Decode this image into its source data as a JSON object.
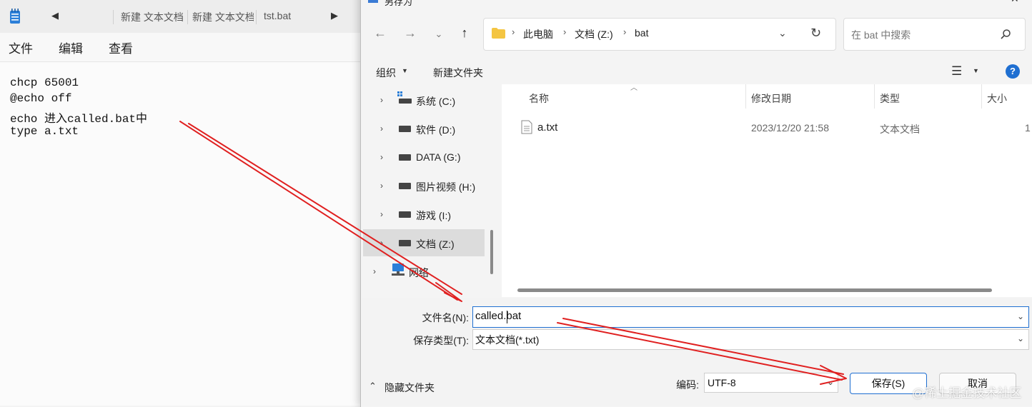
{
  "notepad": {
    "tabs": [
      "新建 文本文档",
      "新建 文本文档",
      "tst.bat"
    ],
    "menu": [
      "文件",
      "编辑",
      "查看"
    ],
    "lines": [
      "chcp 65001",
      "@echo off",
      "echo 进入called.bat中",
      "type a.txt"
    ],
    "icons": {
      "app": "notepad-icon",
      "scroll_left": "chevron-left-icon",
      "scroll_right": "chevron-right-icon"
    }
  },
  "dialog": {
    "title": "另存为",
    "breadcrumb": [
      "此电脑",
      "文档 (Z:)",
      "bat"
    ],
    "search_placeholder": "在 bat 中搜索",
    "toolbar": {
      "organize": "组织",
      "new_folder": "新建文件夹",
      "help": "?"
    },
    "nav": [
      {
        "label": "系统 (C:)",
        "icon": "windows-drive-icon"
      },
      {
        "label": "软件 (D:)",
        "icon": "drive-icon"
      },
      {
        "label": "DATA (G:)",
        "icon": "drive-icon"
      },
      {
        "label": "图片视频 (H:)",
        "icon": "drive-icon"
      },
      {
        "label": "游戏 (I:)",
        "icon": "drive-icon"
      },
      {
        "label": "文档 (Z:)",
        "icon": "drive-icon",
        "selected": true
      },
      {
        "label": "网络",
        "icon": "network-icon"
      }
    ],
    "columns": [
      "名称",
      "修改日期",
      "类型",
      "大小"
    ],
    "files": [
      {
        "name": "a.txt",
        "modified": "2023/12/20 21:58",
        "type": "文本文档",
        "size": "1"
      }
    ],
    "filename_label": "文件名(N):",
    "filename_value": "called.bat",
    "filetype_label": "保存类型(T):",
    "filetype_value": "文本文档(*.txt)",
    "hide_folders": "隐藏文件夹",
    "encoding_label": "编码:",
    "encoding_value": "UTF-8",
    "save": "保存(S)",
    "cancel": "取消"
  },
  "watermark": "@稀土掘金技术社区",
  "colors": {
    "accent": "#1f6fd1",
    "annotation_arrow": "#e02020",
    "folder": "#f4c542"
  }
}
